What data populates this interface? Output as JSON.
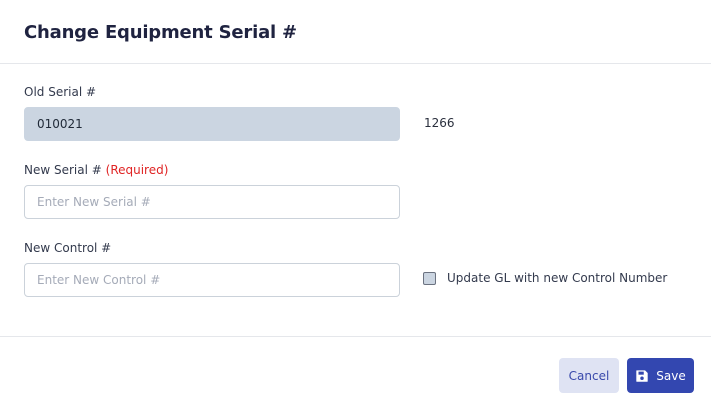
{
  "dialog": {
    "title": "Change Equipment Serial #"
  },
  "old_serial": {
    "label": "Old Serial #",
    "value": "010021",
    "control_number": "1266"
  },
  "new_serial": {
    "label": "New Serial #",
    "required_text": "(Required)",
    "value": "",
    "placeholder": "Enter New Serial #"
  },
  "new_control": {
    "label": "New Control #",
    "value": "",
    "placeholder": "Enter New Control #"
  },
  "update_gl": {
    "label": "Update GL with new Control Number",
    "checked": false
  },
  "footer": {
    "cancel_label": "Cancel",
    "save_label": "Save",
    "save_icon": "floppy-disk-icon"
  },
  "colors": {
    "primary": "#3347b0",
    "cancel_bg": "#dfe3f3",
    "required": "#e02424",
    "readonly_bg": "#cbd5e1"
  }
}
